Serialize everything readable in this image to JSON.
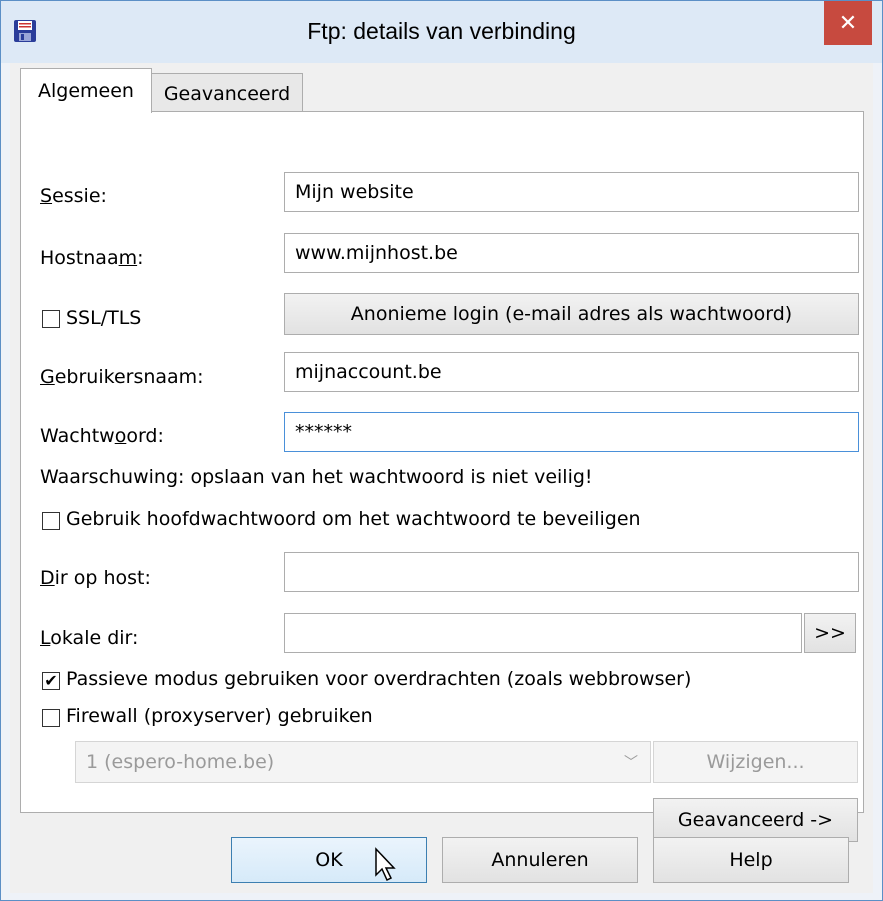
{
  "window": {
    "title": "Ftp: details van verbinding",
    "close_icon": "✕"
  },
  "tabs": [
    {
      "label": "Algemeen",
      "active": true
    },
    {
      "label": "Geavanceerd",
      "active": false
    }
  ],
  "form": {
    "session": {
      "label_prefix": "",
      "label_accel": "S",
      "label_rest": "essie:",
      "value": "Mijn website"
    },
    "hostname": {
      "label_prefix": "Hostnaa",
      "label_accel": "m",
      "label_rest": ":",
      "value": "www.mijnhost.be"
    },
    "ssl": {
      "label": "SSL/TLS",
      "checked": false
    },
    "anon_button": "Anonieme login (e-mail adres als wachtwoord)",
    "username": {
      "label_prefix": "",
      "label_accel": "G",
      "label_rest": "ebruikersnaam:",
      "value": "mijnaccount.be"
    },
    "password": {
      "label_prefix": "Wachtw",
      "label_accel": "o",
      "label_rest": "ord:",
      "value": "******"
    },
    "warning": "Waarschuwing: opslaan van het wachtwoord is niet veilig!",
    "master_password": {
      "label": "Gebruik hoofdwachtwoord om het wachtwoord te beveiligen",
      "checked": false
    },
    "host_dir": {
      "label_prefix": "",
      "label_accel": "D",
      "label_rest": "ir op host:",
      "value": ""
    },
    "local_dir": {
      "label_prefix": "",
      "label_accel": "L",
      "label_rest": "okale dir:",
      "value": "",
      "browse": ">>"
    },
    "passive": {
      "label": "Passieve modus gebruiken voor overdrachten (zoals webbrowser)",
      "checked": true
    },
    "firewall": {
      "label": "Firewall (proxyserver) gebruiken",
      "checked": false
    },
    "proxy_select": {
      "value": "1 (espero-home.be)"
    },
    "change_button": "Wijzigen...",
    "advanced_button": "Geavanceerd ->"
  },
  "footer": {
    "ok": "OK",
    "cancel": "Annuleren",
    "help": "Help"
  },
  "colors": {
    "title_bg": "#dde9f6",
    "close_bg": "#c74a3f",
    "focus_border": "#4a90d9"
  }
}
